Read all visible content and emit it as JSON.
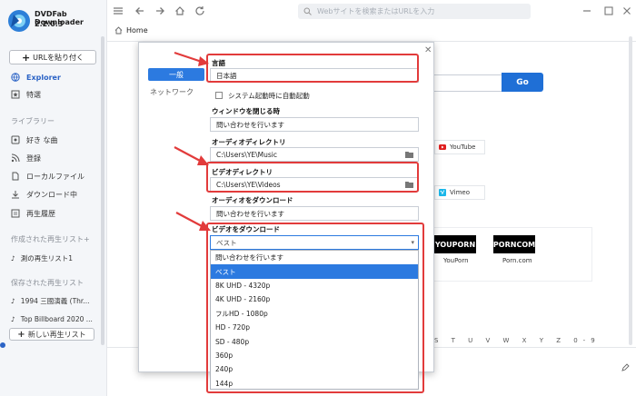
{
  "app": {
    "name": "DVDFab Downloader",
    "version": "2.2.0.3",
    "accent": "#2c64c6"
  },
  "sidebar": {
    "url_button": "URLを貼り付く",
    "nav": [
      {
        "label": "Explorer",
        "icon": "globe-icon",
        "active": true
      },
      {
        "label": "特選",
        "icon": "star-icon",
        "active": false
      }
    ],
    "library_label": "ライブラリー",
    "library": [
      {
        "label": "好き な曲",
        "icon": "heart-icon"
      },
      {
        "label": "登録",
        "icon": "rss-icon"
      },
      {
        "label": "ローカルファイル",
        "icon": "file-icon"
      },
      {
        "label": "ダウンロード中",
        "icon": "download-icon"
      },
      {
        "label": "再生履歴",
        "icon": "history-icon"
      }
    ],
    "created_label": "作成された再生リスト+",
    "created_lists": [
      "測の再生リスト1"
    ],
    "saved_label": "保存された再生リスト",
    "saved_lists": [
      "1994 三國演義 (Thr...",
      "Top Billboard 2020 ..."
    ],
    "new_list_button": "新しい再生リスト"
  },
  "toolbar": {
    "address_placeholder": "Webサイトを検索またはURLを入力",
    "home_tab": "Home"
  },
  "background_page": {
    "go_button": "Go",
    "sites": [
      "YouTube",
      "Vimeo"
    ],
    "logos": [
      {
        "mark": "YOUPORN",
        "caption": "YouPorn"
      },
      {
        "mark": "PORNCOM",
        "caption": "Porn.com"
      }
    ],
    "alphabet": "S T U V W X Y Z 0-9"
  },
  "dialog": {
    "tabs": [
      "一般",
      "ネットワーク"
    ],
    "language_label": "言語",
    "language_value": "日本語",
    "startup_checkbox": "システム起動時に自動起動",
    "on_close_label": "ウィンドウを閉じる時",
    "on_close_value": "問い合わせを行います",
    "audio_dir_label": "オーディオディレクトリ",
    "audio_dir_value": "C:\\Users\\YE\\Music",
    "video_dir_label": "ビデオディレクトリ",
    "video_dir_value": "C:\\Users\\YE\\Videos",
    "audio_dl_label": "オーディオをダウンロード",
    "audio_dl_value": "問い合わせを行います",
    "video_dl_label": "ビデオをダウンロード",
    "video_dl_current": "ベスト",
    "video_dl_options": [
      "問い合わせを行います",
      "ベスト",
      "8K UHD - 4320p",
      "4K UHD - 2160p",
      "フルHD - 1080p",
      "HD - 720p",
      "SD - 480p",
      "360p",
      "240p",
      "144p"
    ],
    "video_dl_selected_index": 1
  },
  "annotation_color": "#e23b3b"
}
